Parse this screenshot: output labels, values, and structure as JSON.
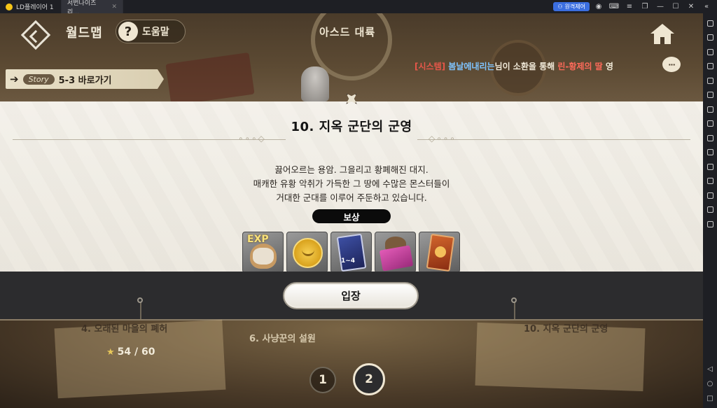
{
  "emulator": {
    "tabs": [
      {
        "label": "LD플레이어 1",
        "active": false
      },
      {
        "label": "서번나이츠 리...",
        "active": true
      }
    ],
    "remote_button": "원격제어",
    "colors": {
      "titlebar": "#1e1f24",
      "accent": "#3b6ee0"
    }
  },
  "hud": {
    "title": "월드맵",
    "help_label": "도움말",
    "help_icon": "?",
    "region_name": "아스드 대륙"
  },
  "story_shortcut": {
    "tag": "Story",
    "label": "5-3 바로가기"
  },
  "system_message": {
    "tag": "[시스템]",
    "name": "봄날에내리는",
    "text1": "님이 소환을 통해 ",
    "item": "린-황제의 딸",
    "text2": " 영"
  },
  "chat_icon_text": "···",
  "dialog": {
    "title": "10. 지옥 군단의 군영",
    "desc_lines": [
      "끓어오르는 용암. 그을리고 황폐해진 대지.",
      "매캐한 유황 악취가 가득한 그 땅에 수많은 몬스터들이",
      "거대한 군대를 이루어 주둔하고 있습니다."
    ],
    "reward_label": "보상",
    "rewards": [
      {
        "name": "exp",
        "text": "EXP"
      },
      {
        "name": "gold-coin"
      },
      {
        "name": "card-pack",
        "text": "1~4"
      },
      {
        "name": "gift-box"
      },
      {
        "name": "tarot-card"
      }
    ],
    "enter_label": "입장"
  },
  "map": {
    "stage_left": "4. 오래된 마을의 폐허",
    "stage_mid": "6. 사냥꾼의 설원",
    "stage_right": "10. 지옥 군단의 군영",
    "stars": "54 / 60",
    "pages": [
      "1",
      "2"
    ],
    "current_page": "2"
  }
}
